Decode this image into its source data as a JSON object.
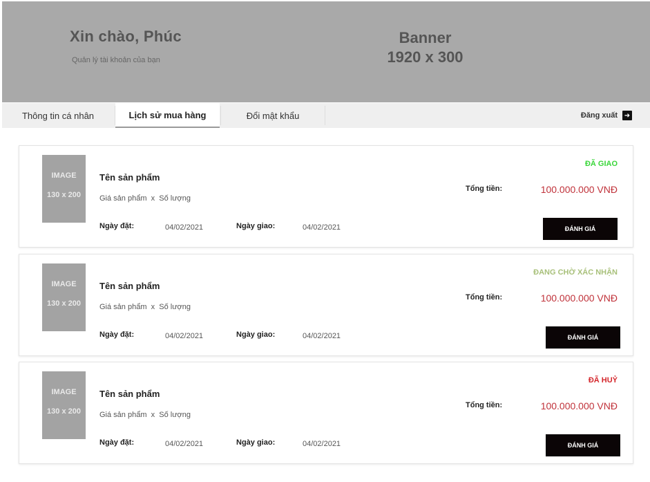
{
  "banner": {
    "greeting": "Xin chào, Phúc",
    "subtitle": "Quản lý tài khoản của bạn",
    "placeholder_line1": "Banner",
    "placeholder_line2": "1920 x 300"
  },
  "tabs": [
    {
      "label": "Thông tin cá nhân",
      "active": false
    },
    {
      "label": "Lịch sử mua hàng",
      "active": true
    },
    {
      "label": "Đổi mật khẩu",
      "active": false
    }
  ],
  "logout": {
    "label": "Đăng xuất",
    "icon": "logout-icon"
  },
  "orders": [
    {
      "image_line1": "IMAGE",
      "image_line2": "130 x 200",
      "product_name": "Tên sản phẩm",
      "price_label": "Giá sản phẩm",
      "times": "x",
      "qty_label": "Số lượng",
      "order_date_label": "Ngày đặt:",
      "order_date": "04/02/2021",
      "delivery_date_label": "Ngày giao:",
      "delivery_date": "04/02/2021",
      "status": "ĐÃ GIAO",
      "status_color": "#3ad63a",
      "total_label": "Tổng tiền:",
      "total": "100.000.000 VNĐ",
      "review_label": "ĐÁNH GIÁ"
    },
    {
      "image_line1": "IMAGE",
      "image_line2": "130 x 200",
      "product_name": "Tên sản phẩm",
      "price_label": "Giá sản phẩm",
      "times": "x",
      "qty_label": "Số lượng",
      "order_date_label": "Ngày đặt:",
      "order_date": "04/02/2021",
      "delivery_date_label": "Ngày giao:",
      "delivery_date": "04/02/2021",
      "status": "ĐANG CHỜ XÁC NHẬN",
      "status_color": "#a8c07a",
      "total_label": "Tổng tiền:",
      "total": "100.000.000 VNĐ",
      "review_label": "ĐÁNH GIÁ"
    },
    {
      "image_line1": "IMAGE",
      "image_line2": "130 x 200",
      "product_name": "Tên sản phẩm",
      "price_label": "Giá sản phẩm",
      "times": "x",
      "qty_label": "Số lượng",
      "order_date_label": "Ngày đặt:",
      "order_date": "04/02/2021",
      "delivery_date_label": "Ngày giao:",
      "delivery_date": "04/02/2021",
      "status": "ĐÃ HUỶ",
      "status_color": "#d4262b",
      "total_label": "Tổng tiền:",
      "total": "100.000.000 VNĐ",
      "review_label": "ĐÁNH GIÁ"
    }
  ]
}
